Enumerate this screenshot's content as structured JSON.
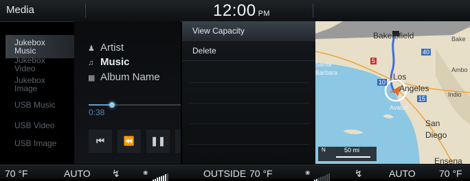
{
  "status_bar": {
    "source": "Media",
    "time": "12:00",
    "ampm": "PM"
  },
  "sidebar": {
    "items": [
      {
        "label": "Jukebox\nMusic",
        "active": true
      },
      {
        "label": "Jukebox\nVideo",
        "active": false
      },
      {
        "label": "Jukebox\nImage",
        "active": false
      },
      {
        "label": "USB Music",
        "active": false
      },
      {
        "label": "USB Video",
        "active": false
      },
      {
        "label": "USB Image",
        "active": false
      }
    ]
  },
  "player": {
    "artist": "Artist",
    "title": "Music",
    "album": "Album Name",
    "elapsed": "0:38",
    "progress_fraction": 0.25
  },
  "menu": {
    "items": [
      {
        "label": "View Capacity",
        "selected": true
      },
      {
        "label": "Delete",
        "selected": false
      }
    ]
  },
  "map": {
    "places": [
      "Bakersfield",
      "Los",
      "Angeles",
      "Santa",
      "Barbara",
      "San",
      "Diego",
      "Ensena",
      "Bake",
      "Ambo",
      "Indio",
      "Avalon"
    ],
    "highways": [
      "5",
      "40",
      "10",
      "15"
    ],
    "scale": "50 mi",
    "compass": "N",
    "route_color": "#3f6fd8",
    "water_color": "#8cc7e3",
    "land_color": "#e8dfc8"
  },
  "climate": {
    "left_temp": "70 °F",
    "left_mode": "AUTO",
    "outside_label": "OUTSIDE",
    "outside_temp": "70 °F",
    "right_mode": "AUTO",
    "right_temp": "70 °F",
    "left_fan_level": 0.9,
    "right_fan_level": 0.3
  }
}
